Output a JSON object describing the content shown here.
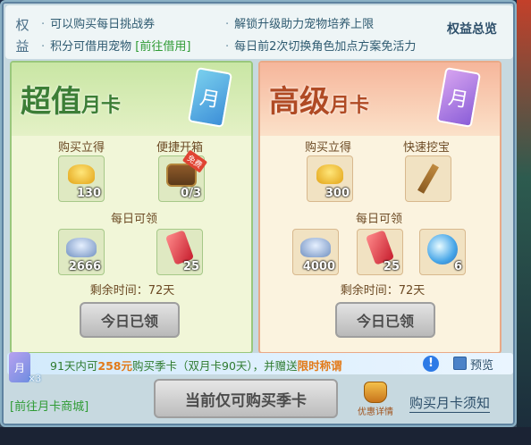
{
  "topbar": {
    "rights_label": "权益",
    "perks": [
      "可以购买每日挑战券",
      "解锁升级助力宠物培养上限",
      "积分可借用宠物",
      "每日前2次切换角色加点方案免活力"
    ],
    "borrow_link": "[前往借用]",
    "overview_label": "权益总览"
  },
  "cards": [
    {
      "title_big": "超值",
      "title_small": "月卡",
      "book_glyph": "月",
      "buy_label": "购买立得",
      "box_label": "便捷开箱",
      "buy_items": [
        {
          "icon": "gold-ingot-icon",
          "qty": "130"
        },
        {
          "icon": "treasure-chest-icon",
          "qty": "0/3",
          "tag": "免费"
        }
      ],
      "daily_label": "每日可领",
      "daily_items": [
        {
          "icon": "silver-ingot-icon",
          "qty": "2666"
        },
        {
          "icon": "ruby-icon",
          "qty": "25"
        }
      ],
      "remain_text": "剩余时间：72天",
      "claimed_label": "今日已领"
    },
    {
      "title_big": "高级",
      "title_small": "月卡",
      "book_glyph": "月",
      "buy_label": "购买立得",
      "box_label": "快速挖宝",
      "buy_items": [
        {
          "icon": "gold-ingot-icon",
          "qty": "300"
        },
        {
          "icon": "shovel-icon",
          "qty": ""
        }
      ],
      "daily_label": "每日可领",
      "daily_items": [
        {
          "icon": "silver-ingot-icon",
          "qty": "4000"
        },
        {
          "icon": "ruby-icon",
          "qty": "25"
        },
        {
          "icon": "spirit-orb-icon",
          "qty": "6"
        }
      ],
      "remain_text": "剩余时间：72天",
      "claimed_label": "今日已领"
    }
  ],
  "promo": {
    "season_glyph": "月",
    "season_mult": "×3",
    "text_a": "91天内可",
    "text_em1": "258元",
    "text_b": "购买季卡（双月卡90天），并赠送",
    "text_em2": "限时称谓",
    "info_glyph": "!",
    "preview_label": "预览"
  },
  "footer": {
    "store_link": "[前往月卡商城]",
    "buy_season_label": "当前仅可购买季卡",
    "discount_label": "优惠详情",
    "notice_label": "购买月卡须知"
  },
  "colors": {
    "left_accent": "#3c7e36",
    "right_accent": "#b04a24",
    "link_green": "#2f9b34",
    "promo_orange": "#e27a19"
  }
}
